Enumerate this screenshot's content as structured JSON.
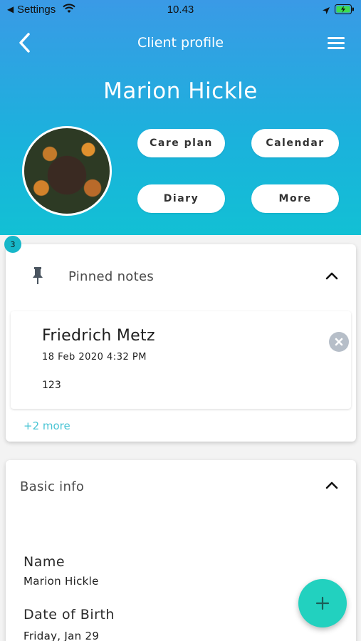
{
  "status_bar": {
    "back_label": "◀",
    "app_label": "Settings",
    "time": "10.43"
  },
  "nav": {
    "title": "Client profile",
    "back_icon": "chevron-left-icon",
    "menu_icon": "hamburger-menu-icon"
  },
  "profile": {
    "name": "Marion Hickle"
  },
  "actions": [
    {
      "label": "Care plan"
    },
    {
      "label": "Calendar"
    },
    {
      "label": "Diary"
    },
    {
      "label": "More"
    }
  ],
  "pinned": {
    "badge_count": "3",
    "title": "Pinned notes",
    "note": {
      "author": "Friedrich Metz",
      "date": "18 Feb 2020 4:32 PM",
      "body": "123"
    },
    "more_link": "+2 more"
  },
  "basic_info": {
    "title": "Basic info",
    "fields": [
      {
        "label": "Name",
        "value": "Marion Hickle"
      },
      {
        "label": "Date of Birth",
        "value": "Friday, Jan 29"
      }
    ]
  },
  "colors": {
    "header_top": "#3a9ae6",
    "header_bottom": "#12c0d4",
    "accent": "#17b7c9",
    "fab": "#22d1bf",
    "link": "#48c4d4"
  }
}
